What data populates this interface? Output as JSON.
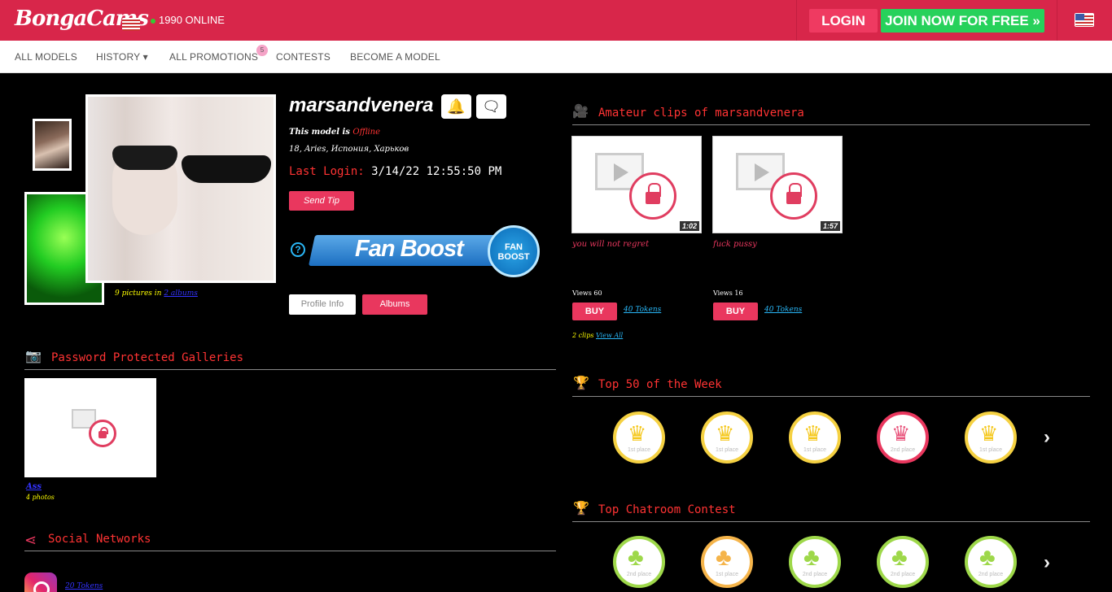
{
  "header": {
    "logo": "BongaCams",
    "online": "1990 ONLINE",
    "login": "LOGIN",
    "join": "JOIN NOW FOR FREE »"
  },
  "nav": {
    "items": [
      "ALL MODELS",
      "HISTORY ▾",
      "ALL PROMOTIONS",
      "CONTESTS",
      "BECOME A MODEL"
    ],
    "promotions_badge": "5"
  },
  "profile": {
    "name": "marsandvenera",
    "status_prefix": "This model is",
    "status": "Offline",
    "details": "18, Aries, Испония, Харьков",
    "last_login_label": "Last Login:",
    "last_login_value": "3/14/22 12:55:50 PM",
    "send_tip": "Send Tip",
    "fan_boost": "Fan Boost",
    "fan_boost_badge": "FAN BOOST",
    "pictures_text": "9 pictures in",
    "albums_link": "2 albums",
    "profile_info": "Profile Info",
    "albums": "Albums"
  },
  "galleries": {
    "title": "Password Protected Galleries",
    "items": [
      {
        "name": "Ass",
        "count": "4 photos"
      }
    ]
  },
  "social": {
    "title": "Social Networks",
    "instagram_tokens": "20 Tokens"
  },
  "clips": {
    "title": "Amateur clips of marsandvenera",
    "items": [
      {
        "duration": "1:02",
        "title": "you will not regret",
        "views": "Views 60",
        "buy": "BUY",
        "tokens": "40 Tokens"
      },
      {
        "duration": "1:57",
        "title": "fuck pussy",
        "views": "Views 16",
        "buy": "BUY",
        "tokens": "40 Tokens"
      }
    ],
    "count": "2 clips",
    "view_all": "View All"
  },
  "top50": {
    "title": "Top 50 of the Week",
    "badges": [
      {
        "place": "1st place",
        "color": "#f5d142"
      },
      {
        "place": "1st place",
        "color": "#f5d142"
      },
      {
        "place": "1st place",
        "color": "#f5d142"
      },
      {
        "place": "2nd place",
        "color": "#e9375e"
      },
      {
        "place": "1st place",
        "color": "#f5d142"
      }
    ]
  },
  "chatroom": {
    "title": "Top Chatroom Contest",
    "badges": [
      {
        "place": "2nd place",
        "color": "#9ed84a"
      },
      {
        "place": "1st place",
        "color": "#f5b44a"
      },
      {
        "place": "2nd place",
        "color": "#9ed84a"
      },
      {
        "place": "2nd place",
        "color": "#9ed84a"
      },
      {
        "place": "2nd place",
        "color": "#9ed84a"
      }
    ]
  },
  "icons": [
    "bell-icon",
    "chat-icon",
    "camera-icon",
    "video-icon",
    "trophy-icon",
    "share-icon",
    "instagram-icon",
    "lock-icon",
    "play-icon",
    "chevron-right-icon"
  ]
}
